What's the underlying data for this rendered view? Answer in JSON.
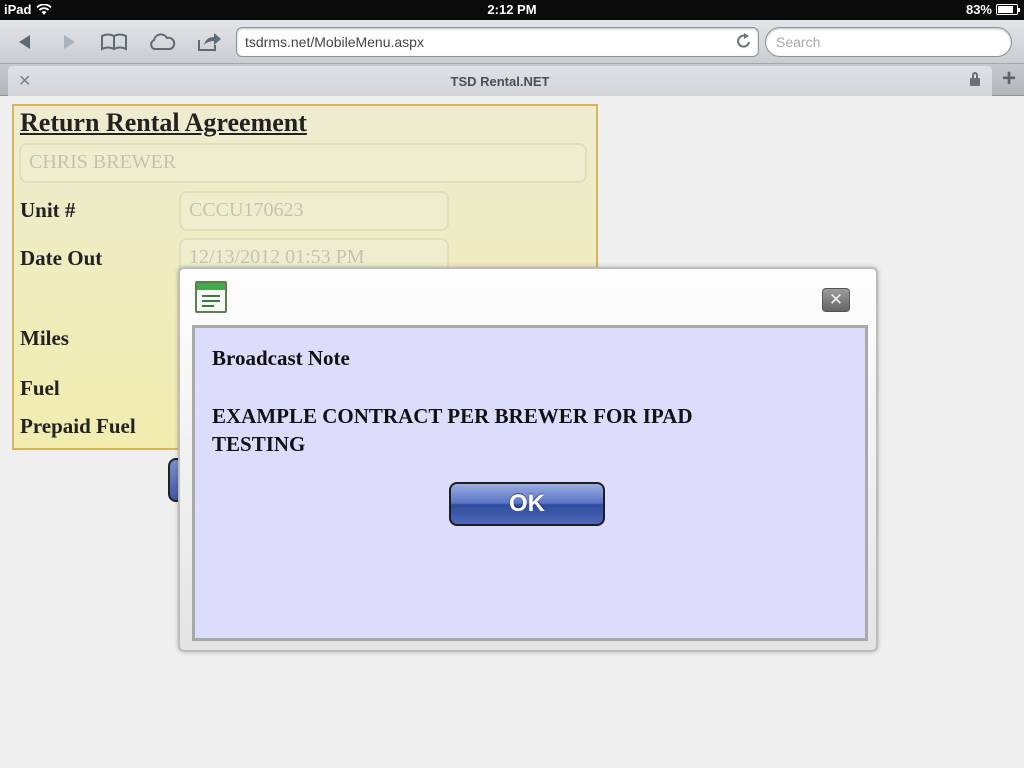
{
  "status_bar": {
    "device": "iPad",
    "time": "2:12 PM",
    "battery_text": "83%",
    "battery_level": 0.83
  },
  "toolbar": {
    "url": "tsdrms.net/MobileMenu.aspx",
    "search_placeholder": "Search"
  },
  "tab": {
    "title": "TSD Rental.NET"
  },
  "form": {
    "title": "Return Rental Agreement",
    "customer_name": "CHRIS BREWER",
    "unit_label": "Unit #",
    "unit_value": "CCCU170623",
    "date_out_label": "Date Out",
    "date_out_value": "12/13/2012 01:53 PM",
    "miles_label": "Miles",
    "fuel_label": "Fuel",
    "prepaid_fuel_label": "Prepaid Fuel"
  },
  "dialog": {
    "title": "Broadcast Note",
    "message": "EXAMPLE CONTRACT PER BREWER FOR IPAD TESTING",
    "ok_label": "OK"
  },
  "icons": {
    "back": "back-arrow-icon",
    "forward": "forward-arrow-icon",
    "bookmarks": "book-icon",
    "cloud": "cloud-icon",
    "share": "share-icon",
    "reload": "reload-icon",
    "close_tab": "close-icon",
    "lock": "lock-icon",
    "new_tab": "plus-icon",
    "wifi": "wifi-icon",
    "battery": "battery-icon",
    "dialog": "window-icon",
    "dialog_close": "close-icon"
  }
}
